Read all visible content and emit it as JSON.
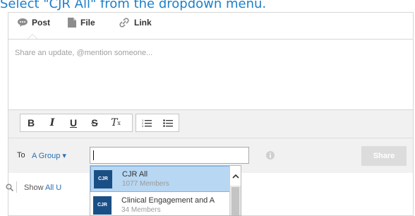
{
  "caption": "Select \"CJR All\" from the dropdown menu.",
  "tabs": [
    {
      "label": "Post",
      "icon": "speech-bubble-icon"
    },
    {
      "label": "File",
      "icon": "document-icon"
    },
    {
      "label": "Link",
      "icon": "link-icon"
    }
  ],
  "editor": {
    "placeholder": "Share an update, @mention someone..."
  },
  "toolbar": {
    "bold": "B",
    "italic": "I",
    "underline": "U",
    "strikethrough": "S",
    "clear_format": "T",
    "clear_format_sub": "x"
  },
  "share": {
    "to_label": "To",
    "group_select": "A Group ▾",
    "recipient_value": "",
    "button_label": "Share"
  },
  "dropdown": {
    "items": [
      {
        "badge": "CJR",
        "name": "CJR All",
        "count": "1077 Members",
        "selected": true
      },
      {
        "badge": "CJR",
        "name": "Clinical Engagement and A",
        "count": "34 Members",
        "selected": false
      }
    ]
  },
  "feed_filter": {
    "show_label": "Show",
    "link_text": "All U"
  },
  "colors": {
    "caption": "#1d7fc9",
    "link": "#2a6fb3",
    "badge": "#1a4f86",
    "selected_row": "#b7d7f3"
  }
}
